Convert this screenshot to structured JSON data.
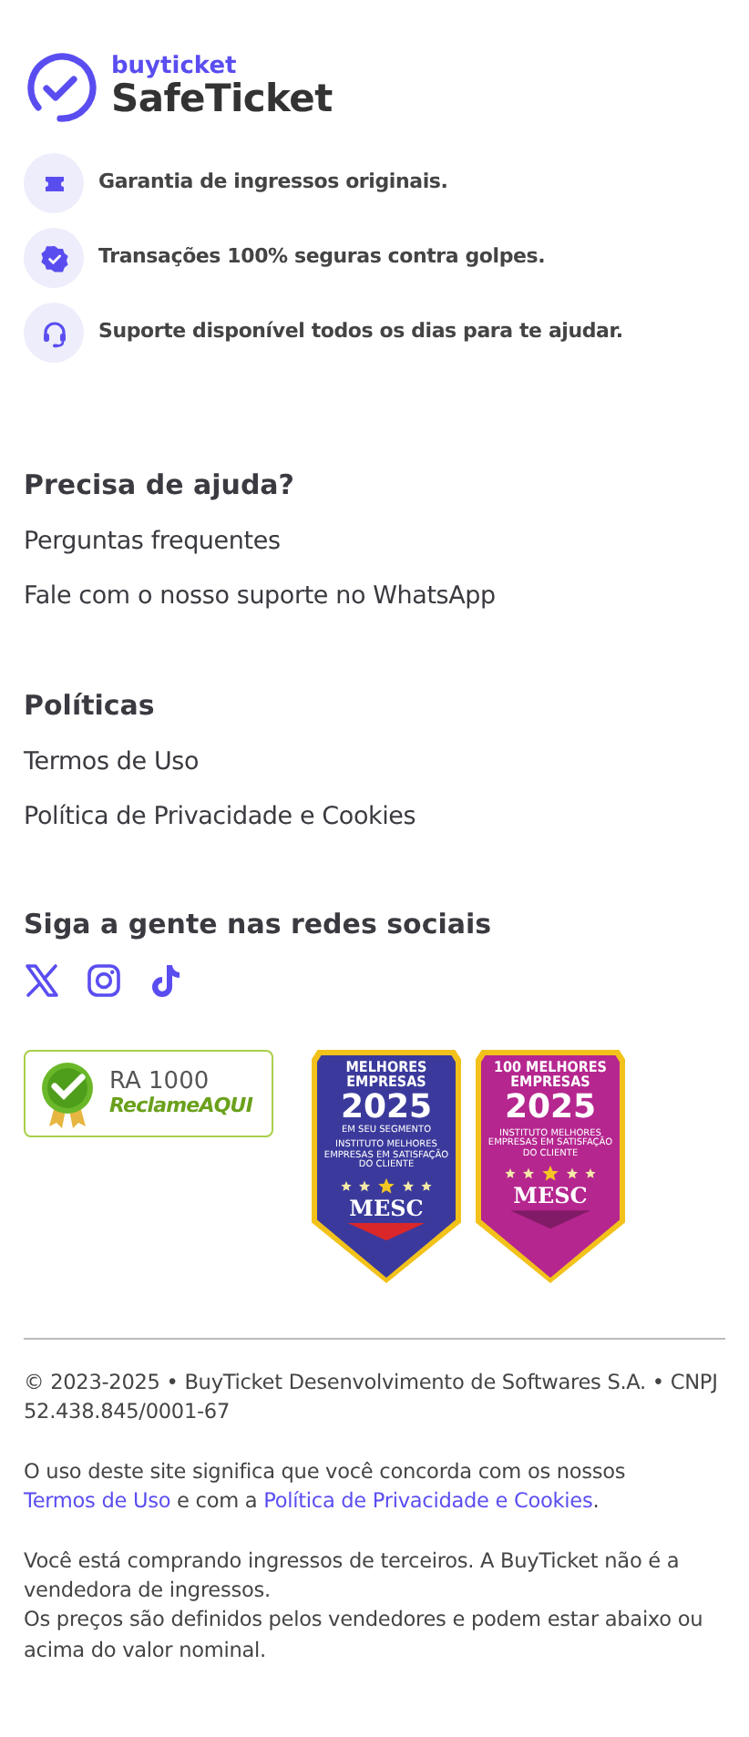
{
  "brand": {
    "name": "buyticket",
    "product": "SafeTicket"
  },
  "features": [
    {
      "kind": "ticket",
      "text": "Garantia de ingressos originais."
    },
    {
      "kind": "shield",
      "text": "Transações 100% seguras contra golpes."
    },
    {
      "kind": "support",
      "text": "Suporte disponível todos os dias para te ajudar."
    }
  ],
  "sections": [
    {
      "title": "Precisa de ajuda?",
      "links": [
        "Perguntas frequentes",
        "Fale com o nosso suporte no WhatsApp"
      ]
    },
    {
      "title": "Políticas",
      "links": [
        "Termos de Uso",
        "Política de Privacidade e Cookies"
      ]
    }
  ],
  "social": {
    "title": "Siga a gente nas redes sociais",
    "networks": [
      {
        "kind": "x"
      },
      {
        "kind": "instagram"
      },
      {
        "kind": "tiktok"
      }
    ]
  },
  "seals": [
    {
      "kind": "reclame",
      "title": "RA 1000",
      "brand": "Reclame**AQUI**"
    },
    {
      "kind": "mesc",
      "color": "#3b3a9c",
      "top": "MELHORES EMPRESAS",
      "year": "2025",
      "sub": "EM SEU SEGMENTO",
      "fine": "INSTITUTO MELHORES EMPRESAS EM SATISFAÇÃO DO CLIENTE",
      "mark": "MESC"
    },
    {
      "kind": "mesc",
      "color": "#b5268f",
      "top": "100 MELHORES EMPRESAS",
      "year": "2025",
      "fine": "INSTITUTO MELHORES EMPRESAS EM SATISFAÇÃO DO CLIENTE",
      "mark": "MESC"
    }
  ],
  "footer": {
    "copyright": "© 2023-2025 • BuyTicket Desenvolvimento de Softwares S.A. • CNPJ 52.438.845/0001-67",
    "consent": [
      {
        "kind": "text",
        "text": "O uso deste site significa que você concorda com os nossos "
      },
      {
        "kind": "link",
        "text": "Termos de Uso"
      },
      {
        "kind": "text",
        "text": " e com a "
      },
      {
        "kind": "link",
        "text": "Política de Privacidade e Cookies"
      },
      {
        "kind": "text",
        "text": "."
      }
    ],
    "notices": [
      "Você está comprando ingressos de terceiros. A BuyTicket não é a vendedora de ingressos.",
      "Os preços são definidos pelos vendedores e podem estar abaixo ou acima do valor nominal."
    ]
  }
}
